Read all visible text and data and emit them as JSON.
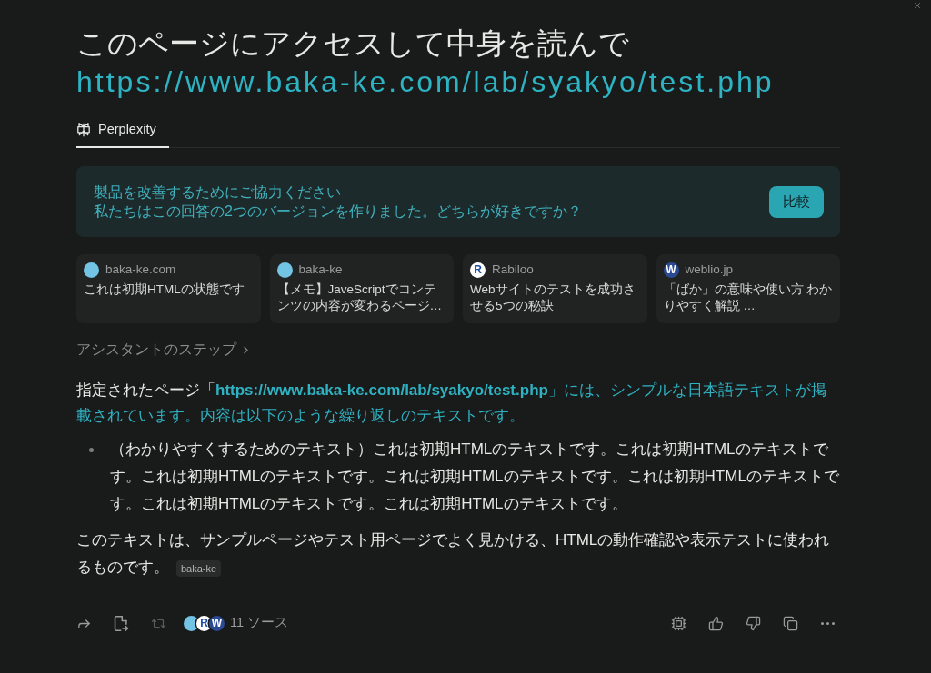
{
  "question": {
    "text": "このページにアクセスして中身を読んで",
    "link": "https://www.baka-ke.com/lab/syakyo/test.php"
  },
  "tabs": [
    {
      "label": "Perplexity",
      "selected": true
    }
  ],
  "feedback_banner": {
    "title": "製品を改善するためにご協力ください",
    "message": "私たちはこの回答の2つのバージョンを作りました。どちらが好きですか？",
    "button": "比較"
  },
  "sources": [
    {
      "domain": "baka-ke.com",
      "title": "これは初期HTMLの状態です",
      "favicon": {
        "kind": "dot",
        "color": "#72c3e4"
      }
    },
    {
      "domain": "baka-ke",
      "title": "【メモ】JaveScriptでコンテンツの内容が変わるページ…",
      "favicon": {
        "kind": "dot",
        "color": "#72c3e4"
      }
    },
    {
      "domain": "Rabiloo",
      "title": "Webサイトのテストを成功させる5つの秘訣",
      "favicon": {
        "kind": "letter",
        "letter": "R",
        "color": "#1d4fa3",
        "filled": false
      }
    },
    {
      "domain": "weblio.jp",
      "title": "「ばか」の意味や使い方 わかりやすく解説 …",
      "favicon": {
        "kind": "letter",
        "letter": "W",
        "color": "#2a4a94",
        "filled": true
      }
    }
  ],
  "assistant_steps": {
    "label": "アシスタントのステップ"
  },
  "answer": {
    "intro": [
      {
        "text": "指定されたページ「",
        "highlighted": false
      },
      {
        "text": "**https://www.baka-ke.com/lab/syakyo/test.php**」には、シンプルな日本語テキストが掲載されています。内容は以下のような繰り返しのテキストです。",
        "highlighted": true
      }
    ],
    "bullets": [
      "（わかりやすくするためのテキスト）これは初期HTMLのテキストです。これは初期HTMLのテキストです。これは初期HTMLのテキストです。これは初期HTMLのテキストです。これは初期HTMLのテキストです。これは初期HTMLのテキストです。これは初期HTMLのテキストです。"
    ],
    "conclusion": {
      "text": "このテキストは、サンプルページやテスト用ページでよく見かける、HTMLの動作確認や表示テストに使われるものです。",
      "citation": "baka-ke"
    }
  },
  "toolbar": {
    "left_actions": [
      {
        "kind": "share",
        "disabled": false
      },
      {
        "kind": "export",
        "disabled": false
      },
      {
        "kind": "rewrite",
        "disabled": true
      }
    ],
    "source_icons": [
      {
        "kind": "dot",
        "color": "#72c3e4"
      },
      {
        "kind": "letter",
        "letter": "R",
        "color": "#1d4fa3",
        "filled": false
      },
      {
        "kind": "letter",
        "letter": "W",
        "color": "#2a4a94",
        "filled": true
      }
    ],
    "sources_label": "11 ソース",
    "right_actions": [
      {
        "kind": "chip"
      },
      {
        "kind": "like"
      },
      {
        "kind": "dislike"
      },
      {
        "kind": "copy"
      },
      {
        "kind": "more"
      }
    ]
  }
}
